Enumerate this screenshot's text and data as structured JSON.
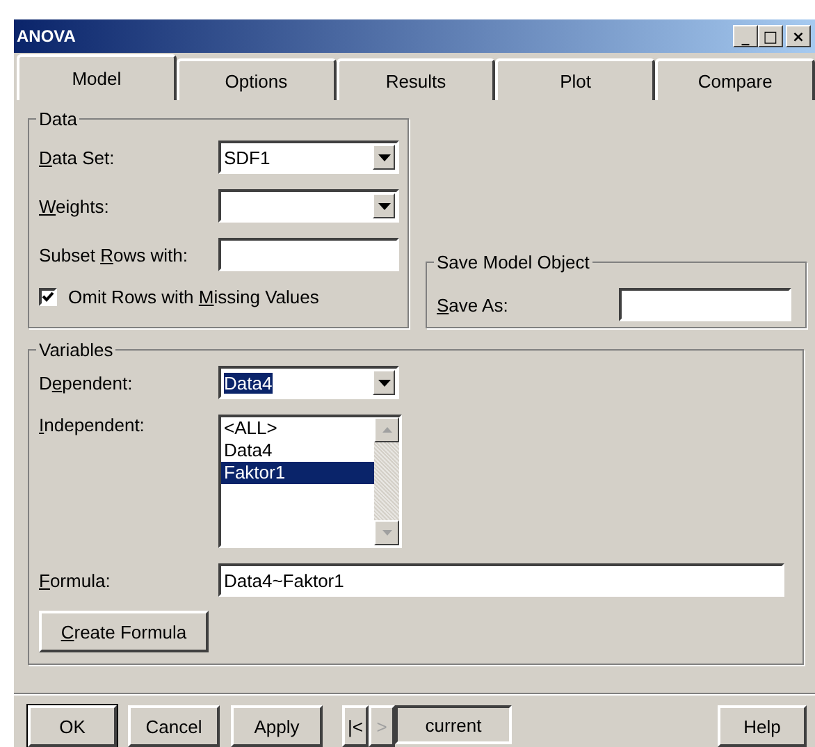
{
  "window": {
    "title": "ANOVA",
    "controls": [
      "_",
      "□",
      "×"
    ]
  },
  "tabs": [
    {
      "label": "Model",
      "selected": true
    },
    {
      "label": "Options",
      "selected": false
    },
    {
      "label": "Results",
      "selected": false
    },
    {
      "label": "Plot",
      "selected": false
    },
    {
      "label": "Compare",
      "selected": false
    }
  ],
  "data_group": {
    "title": "Data",
    "data_set": {
      "label": {
        "key": "D",
        "post": "ata Set:"
      },
      "value": "SDF1"
    },
    "weights": {
      "label": {
        "key": "W",
        "post": "eights:"
      }
    },
    "subset_rows": {
      "label": {
        "pre": "Subset ",
        "key": "R",
        "post": "ows with:"
      }
    },
    "omit_missing": {
      "label": {
        "pre": "Omit Rows with ",
        "key": "M",
        "post": "issing Values"
      },
      "checked": true
    }
  },
  "save_group": {
    "title": "Save Model Object",
    "save_as": {
      "label": {
        "key": "S",
        "post": "ave As:"
      }
    }
  },
  "variables_group": {
    "title": "Variables",
    "dependent": {
      "label": {
        "pre": "D",
        "key": "e",
        "post": "pendent:"
      },
      "value": "Data4",
      "highlighted": true
    },
    "independent": {
      "label": {
        "key": "I",
        "post": "ndependent:"
      },
      "items": [
        {
          "text": "<ALL>",
          "selected": false
        },
        {
          "text": "Data4",
          "selected": false
        },
        {
          "text": "Faktor1",
          "selected": true
        }
      ]
    },
    "formula": {
      "label": {
        "key": "F",
        "post": "ormula:"
      },
      "value": "Data4~Faktor1"
    },
    "create_formula": {
      "key": "C",
      "post": "reate Formula"
    }
  },
  "buttons": [
    {
      "label": "OK",
      "default": true
    },
    {
      "label": "Cancel",
      "default": false
    },
    {
      "label": "Apply",
      "default": false
    }
  ],
  "navigation": {
    "first": {
      "label": "|<",
      "disabled": false
    },
    "next": {
      "label": ">",
      "disabled": true
    },
    "current": "current"
  },
  "help": "Help"
}
